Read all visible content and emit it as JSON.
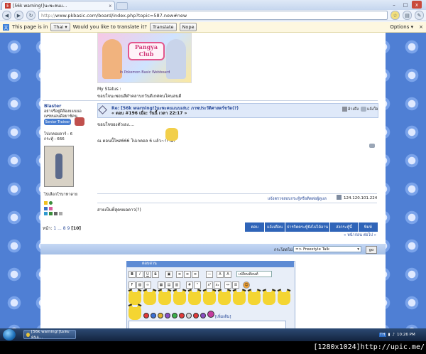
{
  "browser": {
    "tab_title": "[56k warning!]นะพะคนแ...",
    "tab_close": "x",
    "url_scheme": "http://",
    "url_rest": "www.pkbasic.com/board/index.php?topic=587.new#new",
    "window_controls": [
      "–",
      "□",
      "x"
    ]
  },
  "infobar": {
    "prefix": "This page is in",
    "language": "Thai",
    "question": "Would you like to translate it?",
    "translate_label": "Translate",
    "nope_label": "Nope",
    "options_label": "Options"
  },
  "banner": {
    "logo_text": "Pangya Club",
    "sub_text": "In Pokemon Basic Webboard"
  },
  "status_block": {
    "label": "My Status :",
    "text": "ขอบใจนะพอนสีดำคลาบกวันดีเกศคนโคนลนดี"
  },
  "post": {
    "author": "Blaster",
    "author_title_1": "อย่าจรือยู่ดีส้องยแนนอ",
    "author_title_2": "เหรยนอนดีอยาช้คน",
    "rank_badge": "Senior Trainer",
    "posts_label": "โปเกคอยลาร์ : 6",
    "points_label": "กระทู้ : 666",
    "location_label": "ไปเลือกโรบาทาดาย",
    "title": "Re: [56k warning!]นะพะคนแนบเล่น: ภาพประวัติศาสตร์ชวัต(?)",
    "meta": "« ตอบ #196 เมื่อ: วันนี้ เวลา 22:17 »",
    "quote_label": "อ้างถึง",
    "report_label": "แจ้งใจ",
    "body_line1": "ขอบใจของตัวเอง....",
    "body_line2": "ณ ตอนนี้โพส666 โปเกคอล 6 แล้ว~!! เฮ!",
    "report_mod": "แจ้งตรวจสอบกระทู้หรือติดต่อผู้ดูแล",
    "ip": "124.120.101.224",
    "signature": "สายเป็นที่สุดขยอดาว(?)"
  },
  "pagination": {
    "label": "หน้า:",
    "pages": "1 ... 8 9",
    "current": "[10]"
  },
  "nav_buttons": [
    "ตอบ",
    "แจ้งเตือน",
    "ปารกิตตระทู้ยังไม่ได้อาน",
    "ส่งกระทู้นี้",
    "พิมพ์"
  ],
  "prev_next": "« หน้าก่อน ต่อไป »",
  "jump": {
    "label": "กระโดดไป:",
    "selected": "=> Freestyle Talk",
    "go_label": "go"
  },
  "editor": {
    "title": "ตอบด่วน",
    "font_select": "เปลี่ยนฟ้อนท์",
    "more_label": "[เพิ่มเติม]"
  },
  "taskbar": {
    "task_label": "[56k warning!]นะพะคนแ...",
    "clock": "10:26 PM",
    "lang": "TH"
  },
  "watermark": "[1280x1024]http://upic.me/",
  "colors": {
    "page_background": "#4f7fd4",
    "header_band": "#dfe9f9",
    "nav_button": "#2f64b8"
  }
}
